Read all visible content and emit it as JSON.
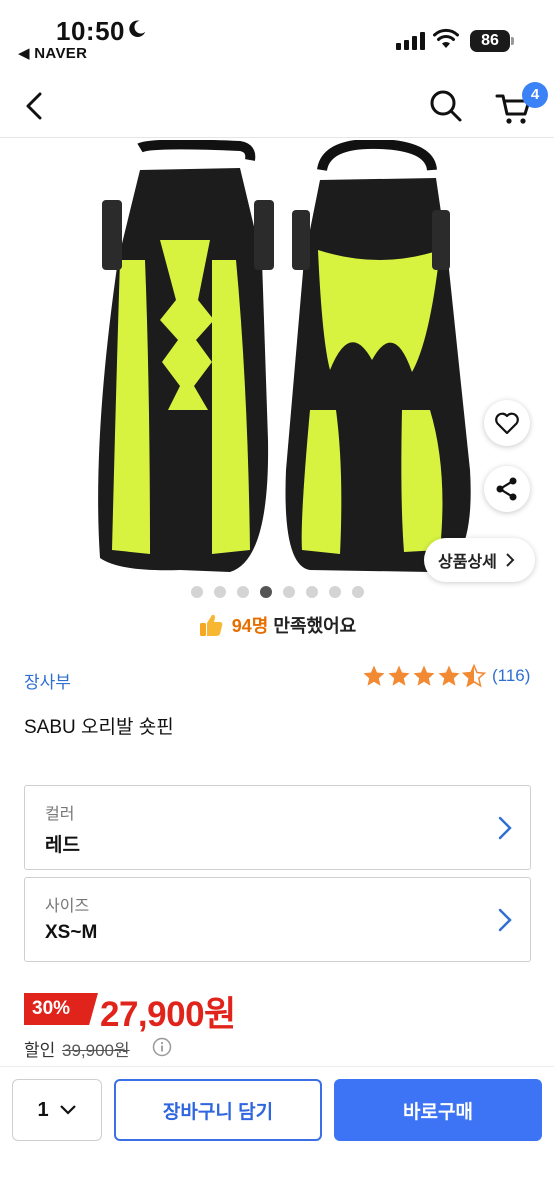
{
  "status_bar": {
    "time": "10:50",
    "back_app": "◀ NAVER",
    "battery": "86"
  },
  "nav": {
    "cart_count": "4"
  },
  "colors": {
    "accent_blue": "#3d74f5",
    "sale_red": "#e0241b",
    "star_orange": "#f28a33"
  },
  "gallery": {
    "dot_count": 8,
    "active_dot_index": 3,
    "detail_button_label": "상품상세",
    "satisfied_count": "94명",
    "satisfied_text": "만족했어요"
  },
  "product": {
    "seller": "장사부",
    "rating": 4.5,
    "review_count": "(116)",
    "title": "SABU 오리발 숏핀"
  },
  "options": [
    {
      "label": "컬러",
      "value": "레드"
    },
    {
      "label": "사이즈",
      "value": "XS~M"
    }
  ],
  "price": {
    "discount": "30%",
    "sale_price": "27,900원",
    "discount_label": "할인",
    "original_price": "39,900원"
  },
  "bottom_bar": {
    "quantity": "1",
    "add_to_cart": "장바구니 담기",
    "buy_now": "바로구매"
  },
  "icons": [
    "moon-icon",
    "wifi-icon",
    "back-arrow-icon",
    "search-icon",
    "cart-icon",
    "heart-icon",
    "share-icon",
    "thumbs-up-icon",
    "star-icon",
    "chevron-right-icon",
    "info-icon",
    "chevron-down-icon"
  ]
}
